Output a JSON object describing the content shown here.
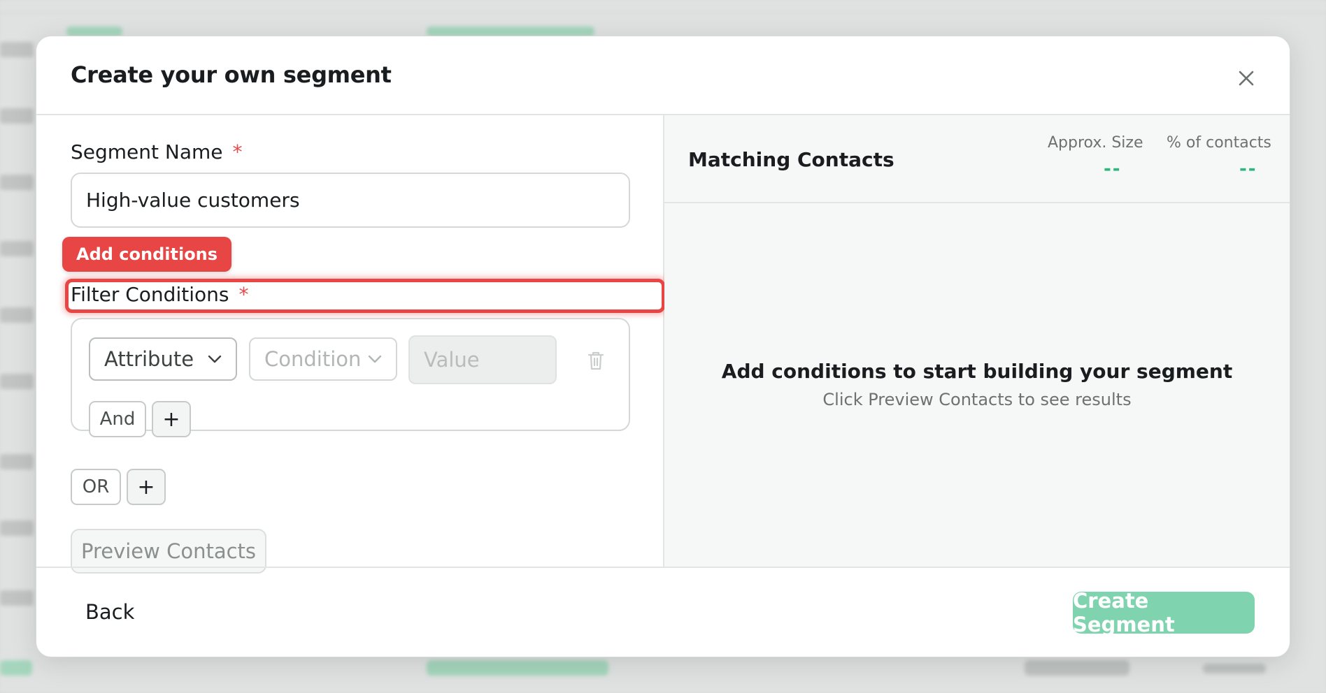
{
  "modal": {
    "title": "Create your own segment"
  },
  "form": {
    "segment_name_label": "Segment Name",
    "required_marker": "*",
    "segment_name_value": "High-value customers",
    "tooltip": "Add conditions",
    "filter_label": "Filter Conditions",
    "condition_row": {
      "attribute_placeholder": "Attribute",
      "condition_placeholder": "Condition",
      "value_placeholder": "Value"
    },
    "and_label": "And",
    "plus_label": "+",
    "or_label": "OR",
    "preview_label": "Preview Contacts"
  },
  "matching": {
    "title": "Matching Contacts",
    "approx_size_label": "Approx. Size",
    "approx_size_value": "--",
    "percent_label": "% of contacts",
    "percent_value": "--",
    "empty_title": "Add conditions to start building your segment",
    "empty_subtitle": "Click Preview Contacts to see results"
  },
  "footer": {
    "back_label": "Back",
    "create_label": "Create Segment"
  },
  "colors": {
    "accent": "#7fd4af",
    "highlight": "#e84545",
    "stat_value": "#2fb67f"
  }
}
